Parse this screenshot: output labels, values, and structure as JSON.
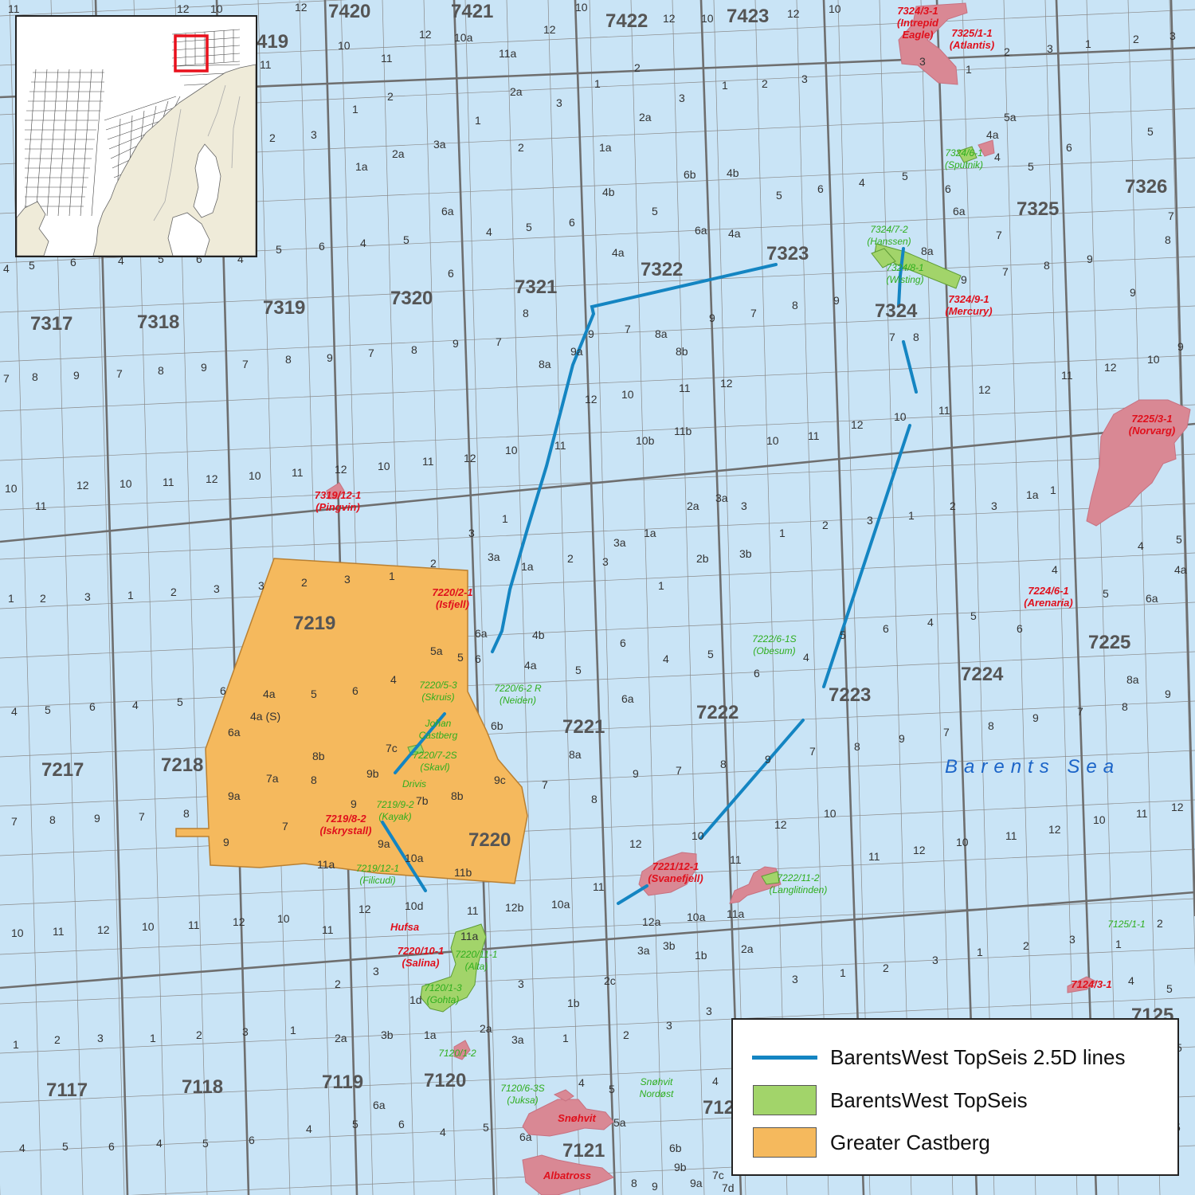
{
  "colors": {
    "sea": "#c9e4f6",
    "grid": "#6e6e6e",
    "castberg": "#f5b95d",
    "topseis": "#a2d46a",
    "lines": "#1485c2",
    "field_red": "#d98894",
    "red_text": "#e0101c",
    "green_text": "#2fae1e",
    "sea_label": "#1b64c8"
  },
  "sea_label": "Barents Sea",
  "quadrants": [
    {
      "id": "7420",
      "label": "7420"
    },
    {
      "id": "7421",
      "label": "7421"
    },
    {
      "id": "7422",
      "label": "7422"
    },
    {
      "id": "7423",
      "label": "7423"
    },
    {
      "id": "419",
      "label": "419"
    },
    {
      "id": "7326",
      "label": "7326"
    },
    {
      "id": "7325",
      "label": "7325"
    },
    {
      "id": "7323",
      "label": "7323"
    },
    {
      "id": "7322",
      "label": "7322"
    },
    {
      "id": "7321",
      "label": "7321"
    },
    {
      "id": "7320",
      "label": "7320"
    },
    {
      "id": "7319",
      "label": "7319"
    },
    {
      "id": "7318",
      "label": "7318"
    },
    {
      "id": "7317",
      "label": "7317"
    },
    {
      "id": "7324",
      "label": "7324"
    },
    {
      "id": "7219",
      "label": "7219"
    },
    {
      "id": "7218",
      "label": "7218"
    },
    {
      "id": "7217",
      "label": "7217"
    },
    {
      "id": "7220",
      "label": "7220"
    },
    {
      "id": "7221",
      "label": "7221"
    },
    {
      "id": "7222",
      "label": "7222"
    },
    {
      "id": "7223",
      "label": "7223"
    },
    {
      "id": "7224",
      "label": "7224"
    },
    {
      "id": "7225",
      "label": "7225"
    },
    {
      "id": "7117",
      "label": "7117"
    },
    {
      "id": "7118",
      "label": "7118"
    },
    {
      "id": "7119",
      "label": "7119"
    },
    {
      "id": "7120",
      "label": "7120"
    },
    {
      "id": "7121",
      "label": "7121"
    },
    {
      "id": "712",
      "label": "712"
    },
    {
      "id": "7125",
      "label": "7125"
    }
  ],
  "wells_red": [
    {
      "id": "w7324-3-1",
      "lines": [
        "7324/3-1",
        "(Intrepid",
        "Eagle)"
      ]
    },
    {
      "id": "w7325-1-1",
      "lines": [
        "7325/1-1",
        "(Atlantis)"
      ]
    },
    {
      "id": "w7324-9-1",
      "lines": [
        "7324/9-1",
        "(Mercury)"
      ]
    },
    {
      "id": "w7225-3-1",
      "lines": [
        "7225/3-1",
        "(Norvarg)"
      ]
    },
    {
      "id": "w7319-12-1",
      "lines": [
        "7319/12-1",
        "(Pingvin)"
      ]
    },
    {
      "id": "w7220-2-1",
      "lines": [
        "7220/2-1",
        "(Isfjell)"
      ]
    },
    {
      "id": "w7224-6-1",
      "lines": [
        "7224/6-1",
        "(Arenaria)"
      ]
    },
    {
      "id": "w7219-8-2",
      "lines": [
        "7219/8-2",
        "(Iskrystall)"
      ]
    },
    {
      "id": "w7221-12-1",
      "lines": [
        "7221/12-1",
        "(Svanefjell)"
      ]
    },
    {
      "id": "w-hufsa",
      "lines": [
        "Hufsa"
      ]
    },
    {
      "id": "w7220-10-1",
      "lines": [
        "7220/10-1",
        "(Salina)"
      ]
    },
    {
      "id": "w7124-3-1",
      "lines": [
        "7124/3-1"
      ]
    },
    {
      "id": "w-snohvit",
      "lines": [
        "Snøhvit"
      ]
    },
    {
      "id": "w-albatross",
      "lines": [
        "Albatross"
      ]
    }
  ],
  "wells_green": [
    {
      "id": "g7324-6-1",
      "lines": [
        "7324/6-1",
        "(Sputnik)"
      ]
    },
    {
      "id": "g7324-7-2",
      "lines": [
        "7324/7-2",
        "(Hanssen)"
      ]
    },
    {
      "id": "g7324-8-1",
      "lines": [
        "7324/8-1",
        "(Wisting)"
      ]
    },
    {
      "id": "g7222-6-1s",
      "lines": [
        "7222/6-1S",
        "(Obesum)"
      ]
    },
    {
      "id": "g7220-5-3",
      "lines": [
        "7220/5-3",
        "(Skruis)"
      ]
    },
    {
      "id": "g7220-6-2r",
      "lines": [
        "7220/6-2 R",
        "(Neiden)"
      ]
    },
    {
      "id": "g-johan",
      "lines": [
        "Johan",
        "Castberg"
      ]
    },
    {
      "id": "g7220-7-2s",
      "lines": [
        "7220/7-2S",
        "(Skavl)"
      ]
    },
    {
      "id": "g-drivis",
      "lines": [
        "Drivis"
      ]
    },
    {
      "id": "g7219-9-2",
      "lines": [
        "7219/9-2",
        "(Kayak)"
      ]
    },
    {
      "id": "g7219-12-1",
      "lines": [
        "7219/12-1",
        "(Filicudi)"
      ]
    },
    {
      "id": "g7222-11-2",
      "lines": [
        "7222/11-2",
        "(Langlitinden)"
      ]
    },
    {
      "id": "g7220-11-1",
      "lines": [
        "7220/11-1",
        "(Alta)"
      ]
    },
    {
      "id": "g7120-1-3",
      "lines": [
        "7120/1-3",
        "(Gohta)"
      ]
    },
    {
      "id": "g7125-1-1",
      "lines": [
        "7125/1-1"
      ]
    },
    {
      "id": "g7120-1-2",
      "lines": [
        "7120/1-2"
      ]
    },
    {
      "id": "g7120-6-3s",
      "lines": [
        "7120/6-3S",
        "(Juksa)"
      ]
    },
    {
      "id": "g-snohvit-nordost",
      "lines": [
        "Snøhvit",
        "Nordøst"
      ]
    }
  ],
  "legend": [
    {
      "label": "BarentsWest TopSeis 2.5D lines",
      "symbol": "line",
      "color": "#1485c2"
    },
    {
      "label": "BarentsWest TopSeis",
      "symbol": "box",
      "color": "#a2d46a"
    },
    {
      "label": "Greater Castberg",
      "symbol": "box",
      "color": "#f5b95d"
    }
  ]
}
